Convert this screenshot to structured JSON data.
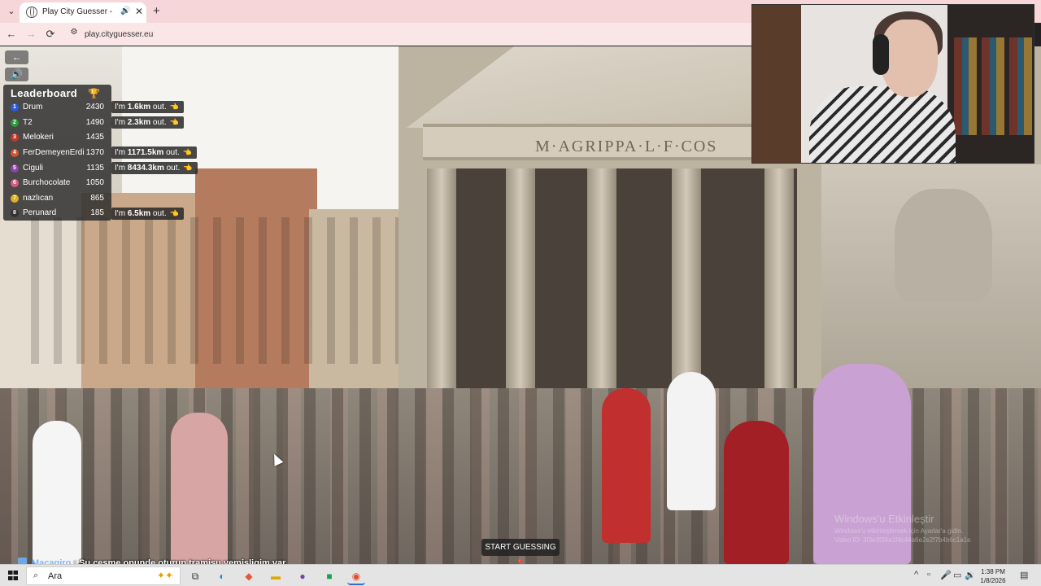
{
  "browser": {
    "tab_title": "Play City Guesser - Explore",
    "tab_audio_icon": "speaker-icon",
    "tab_close": "✕",
    "new_tab": "+",
    "url": "play.cityguesser.eu",
    "back": "←",
    "forward": "→",
    "reload": "⟳"
  },
  "game": {
    "back_button_icon": "arrow-left-icon",
    "sound_button_icon": "speaker-icon",
    "leaderboard": {
      "title": "Leaderboard",
      "trophy_icon": "trophy-icon",
      "rows": [
        {
          "rank": "1",
          "name": "Drum",
          "score": "2430",
          "color": "#2a5bd7"
        },
        {
          "rank": "2",
          "name": "T2",
          "score": "1490",
          "color": "#2d9b3a"
        },
        {
          "rank": "3",
          "name": "Melokeri",
          "score": "1435",
          "color": "#c0392b"
        },
        {
          "rank": "4",
          "name": "FerDemeyenErdi",
          "score": "1370",
          "color": "#d3542e"
        },
        {
          "rank": "5",
          "name": "Ciguli",
          "score": "1135",
          "color": "#8e44ad"
        },
        {
          "rank": "6",
          "name": "Burchocolate",
          "score": "1050",
          "color": "#d45a88"
        },
        {
          "rank": "7",
          "name": "nazlıcan",
          "score": "865",
          "color": "#e0b020"
        },
        {
          "rank": "8",
          "name": "Perunard",
          "score": "185",
          "color": "#333333"
        }
      ]
    },
    "guesses": [
      {
        "prefix": "I'm ",
        "distance": "1.6km",
        "suffix": " out."
      },
      {
        "prefix": "I'm ",
        "distance": "2.3km",
        "suffix": " out."
      },
      {
        "prefix": "I'm ",
        "distance": "1171.5km",
        "suffix": " out."
      },
      {
        "prefix": "I'm ",
        "distance": "8434.3km",
        "suffix": " out."
      },
      {
        "prefix": "I'm ",
        "distance": "6.5km",
        "suffix": " out."
      }
    ],
    "start_guessing": "START GUESSING",
    "start_icon": "map-pin-icon",
    "scene_inscription": "M·AGRIPPA·L·F·COS"
  },
  "watermark": {
    "title": "Windows'u Etkinleştir",
    "subtitle": "Windows'u etkinleştirmek için Ayarlar'a gidin.",
    "video_id": "Video ID: 3f3e3f39a1f4c44a6e2e2f7b4b6c1a1e"
  },
  "chat": {
    "user": "Macagiro",
    "separator": " : ",
    "message": "Su cesme onunde oturup tramisu yemisligim var"
  },
  "taskbar": {
    "search_placeholder": "Ara",
    "time": "1:38 PM",
    "date": "1/8/2026"
  }
}
